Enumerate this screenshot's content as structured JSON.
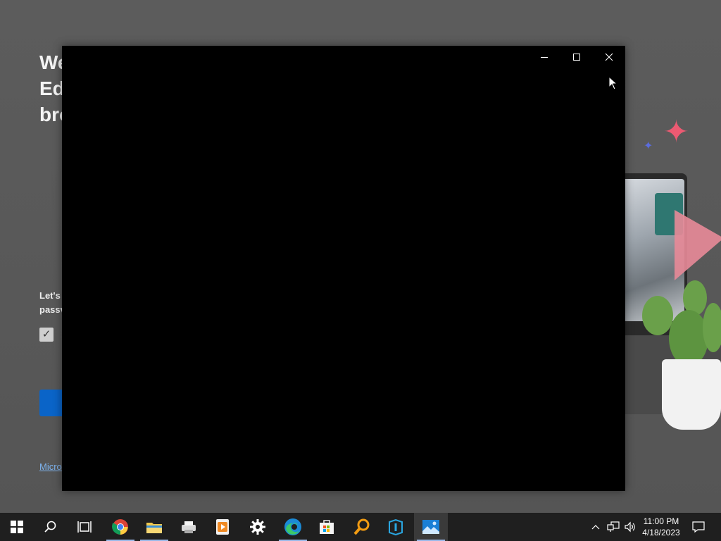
{
  "background_window": {
    "title_lines": [
      "We",
      "Ed",
      "bro"
    ],
    "body_lines": [
      "Let's",
      "passv"
    ],
    "checkbox_checked": true,
    "link_text": "Micro"
  },
  "app_window": {
    "background": "#000000",
    "controls": {
      "minimize": "minimize-icon",
      "maximize": "maximize-icon",
      "close": "close-icon"
    }
  },
  "taskbar": {
    "apps": [
      {
        "name": "start",
        "icon": "windows-logo-icon"
      },
      {
        "name": "search",
        "icon": "search-icon"
      },
      {
        "name": "task-view",
        "icon": "task-view-icon"
      },
      {
        "name": "chrome",
        "icon": "chrome-icon"
      },
      {
        "name": "file-explorer",
        "icon": "folder-icon"
      },
      {
        "name": "app-5",
        "icon": "printer-icon"
      },
      {
        "name": "app-6",
        "icon": "media-player-icon"
      },
      {
        "name": "settings",
        "icon": "gear-icon"
      },
      {
        "name": "edge",
        "icon": "edge-icon"
      },
      {
        "name": "store",
        "icon": "store-icon"
      },
      {
        "name": "search-app",
        "icon": "magnifier-app-icon"
      },
      {
        "name": "app-11",
        "icon": "app-icon"
      },
      {
        "name": "photos",
        "icon": "photos-icon"
      }
    ],
    "active_app": "photos",
    "clock": {
      "time": "11:00 PM",
      "date": "4/18/2023"
    }
  }
}
